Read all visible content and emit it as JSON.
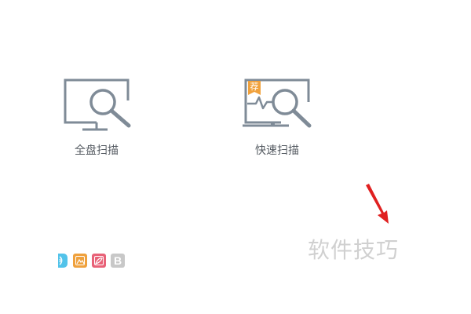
{
  "scan_options": [
    {
      "label": "全盘扫描",
      "icon": "monitor-magnifier-icon"
    },
    {
      "label": "快速扫描",
      "icon": "laptop-heartbeat-magnifier-icon",
      "badge": "荐"
    }
  ],
  "toolbar_icons": [
    "wave-icon",
    "image-icon",
    "brush-icon",
    "letter-b-icon"
  ],
  "toolbar_letter": "B",
  "watermark": "软件技巧",
  "annotation": {
    "icon": "red-arrow-icon",
    "color": "#e02020"
  },
  "colors": {
    "icon_stroke": "#7f8b97",
    "badge": "#f0a13c",
    "label_text": "#555b62"
  }
}
